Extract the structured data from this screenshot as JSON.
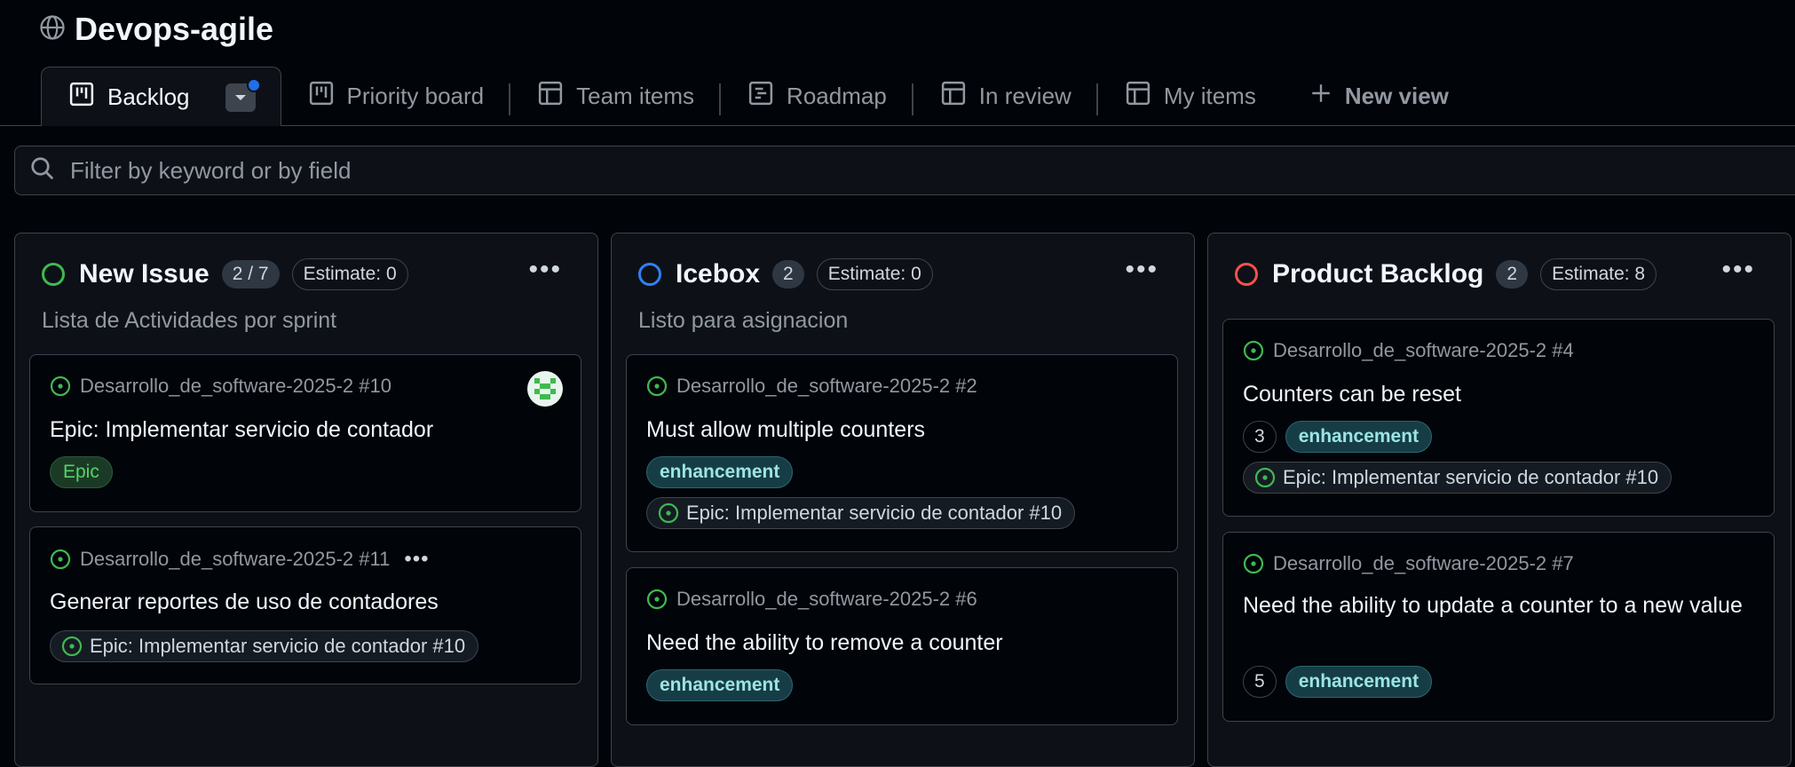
{
  "project": {
    "title": "Devops-agile"
  },
  "tabs": [
    {
      "label": "Backlog"
    },
    {
      "label": "Priority board"
    },
    {
      "label": "Team items"
    },
    {
      "label": "Roadmap"
    },
    {
      "label": "In review"
    },
    {
      "label": "My items"
    },
    {
      "label": "New view"
    }
  ],
  "filter": {
    "placeholder": "Filter by keyword or by field"
  },
  "colors": {
    "green": "#3fb950",
    "blue": "#2f81f7",
    "red": "#f85149",
    "accent": "#1f6feb"
  },
  "columns": [
    {
      "name": "New Issue",
      "count": "2 / 7",
      "estimate": "Estimate: 0",
      "description": "Lista de Actividades por sprint",
      "cards": [
        {
          "ref": "Desarrollo_de_software-2025-2 #10",
          "title": "Epic: Implementar servicio de contador",
          "label": "Epic"
        },
        {
          "ref": "Desarrollo_de_software-2025-2 #11",
          "title": "Generar reportes de uso de contadores",
          "parent": "Epic: Implementar servicio de contador #10"
        }
      ]
    },
    {
      "name": "Icebox",
      "count": "2",
      "estimate": "Estimate: 0",
      "description": "Listo para asignacion",
      "cards": [
        {
          "ref": "Desarrollo_de_software-2025-2 #2",
          "title": "Must allow multiple counters",
          "label": "enhancement",
          "parent": "Epic: Implementar servicio de contador #10"
        },
        {
          "ref": "Desarrollo_de_software-2025-2 #6",
          "title": "Need the ability to remove a counter",
          "label": "enhancement"
        }
      ]
    },
    {
      "name": "Product Backlog",
      "count": "2",
      "estimate": "Estimate: 8",
      "cards": [
        {
          "ref": "Desarrollo_de_software-2025-2 #4",
          "title": "Counters can be reset",
          "estimate": "3",
          "label": "enhancement",
          "parent": "Epic: Implementar servicio de contador #10"
        },
        {
          "ref": "Desarrollo_de_software-2025-2 #7",
          "title": "Need the ability to update a counter to a new value",
          "estimate": "5",
          "label": "enhancement"
        }
      ]
    }
  ]
}
